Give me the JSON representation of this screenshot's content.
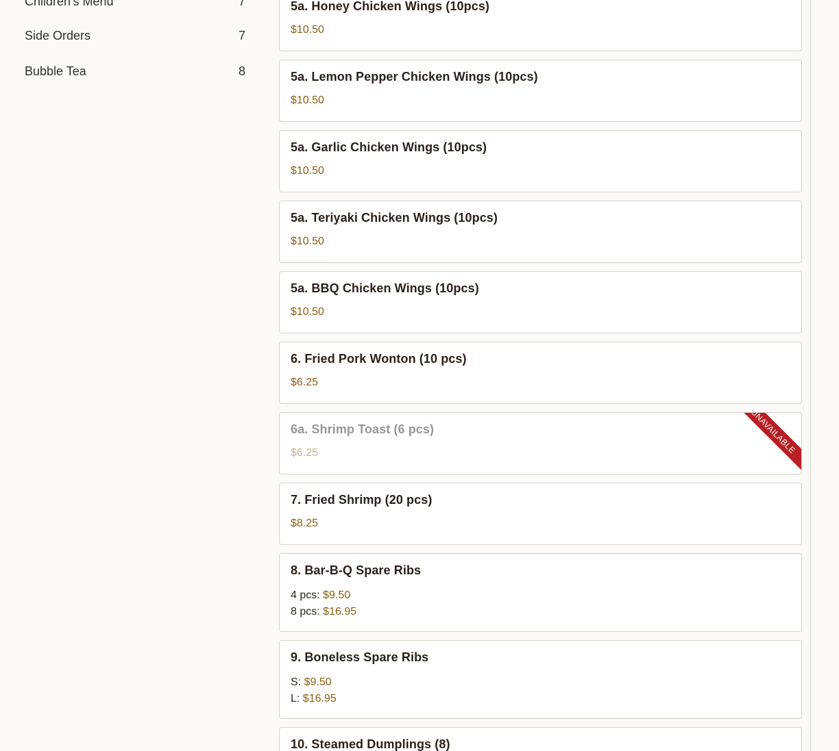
{
  "sidebar": {
    "categories": [
      {
        "label": "Children's Menu",
        "count": "7"
      },
      {
        "label": "Side Orders",
        "count": "7"
      },
      {
        "label": "Bubble Tea",
        "count": "8"
      }
    ]
  },
  "menu": {
    "items": [
      {
        "name": "5a. Honey Chicken Wings (10pcs)",
        "price": "$10.50"
      },
      {
        "name": "5a. Lemon Pepper Chicken Wings (10pcs)",
        "price": "$10.50"
      },
      {
        "name": "5a. Garlic Chicken Wings (10pcs)",
        "price": "$10.50"
      },
      {
        "name": "5a. Teriyaki Chicken Wings (10pcs)",
        "price": "$10.50"
      },
      {
        "name": "5a. BBQ Chicken Wings (10pcs)",
        "price": "$10.50"
      },
      {
        "name": "6. Fried Pork Wonton (10 pcs)",
        "price": "$6.25"
      },
      {
        "name": "6a. Shrimp Toast (6 pcs)",
        "price": "$6.25",
        "badge": "UNAVAILABLE"
      },
      {
        "name": "7. Fried Shrimp (20 pcs)",
        "price": "$8.25"
      },
      {
        "name": "8. Bar-B-Q Spare Ribs",
        "options": [
          {
            "label": "4 pcs:",
            "price": "$9.50"
          },
          {
            "label": "8 pcs:",
            "price": "$16.95"
          }
        ]
      },
      {
        "name": "9. Boneless Spare Ribs",
        "options": [
          {
            "label": "S:",
            "price": "$9.50"
          },
          {
            "label": "L:",
            "price": "$16.95"
          }
        ]
      },
      {
        "name": "10. Steamed Dumplings (8)"
      }
    ]
  },
  "colors": {
    "price": "#8b5e12",
    "unavailable_ribbon": "#b81f24",
    "background": "#fbfaf8"
  }
}
